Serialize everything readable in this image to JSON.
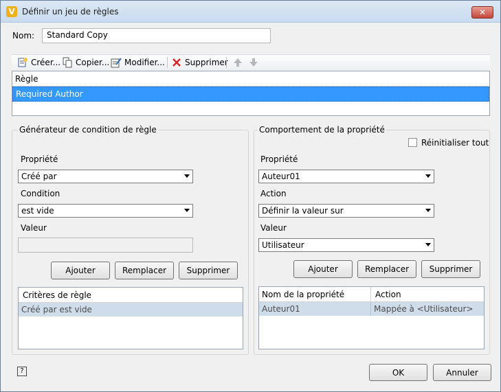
{
  "window": {
    "title": "Définir un jeu de règles",
    "app_icon_letter": "V",
    "close_label": "✕"
  },
  "name_field": {
    "label": "Nom:",
    "value": "Standard Copy"
  },
  "toolbar": {
    "create": "Créer...",
    "copy": "Copier...",
    "modify": "Modifier...",
    "delete": "Supprimer"
  },
  "rules_grid": {
    "header": "Règle",
    "rows": [
      "Required Author"
    ]
  },
  "left_group": {
    "title": "Générateur de condition de règle",
    "property_label": "Propriété",
    "property_value": "Créé par",
    "condition_label": "Condition",
    "condition_value": "est vide",
    "value_label": "Valeur",
    "value_value": "",
    "add": "Ajouter",
    "replace": "Remplacer",
    "delete": "Supprimer",
    "criteria_header": "Critères de règle",
    "criteria_rows": [
      "Créé par est vide"
    ]
  },
  "right_group": {
    "title": "Comportement de la propriété",
    "reset_all": "Réinitialiser tout",
    "property_label": "Propriété",
    "property_value": "Auteur01",
    "action_label": "Action",
    "action_value": "Définir la valeur sur",
    "value_label": "Valeur",
    "value_value": "Utilisateur",
    "add": "Ajouter",
    "replace": "Remplacer",
    "delete": "Supprimer",
    "table_headers": [
      "Nom de la propriété",
      "Action"
    ],
    "table_rows": [
      [
        "Auteur01",
        "Mappée à <Utilisateur>"
      ]
    ]
  },
  "footer": {
    "ok": "OK",
    "cancel": "Annuler",
    "help": "?"
  }
}
